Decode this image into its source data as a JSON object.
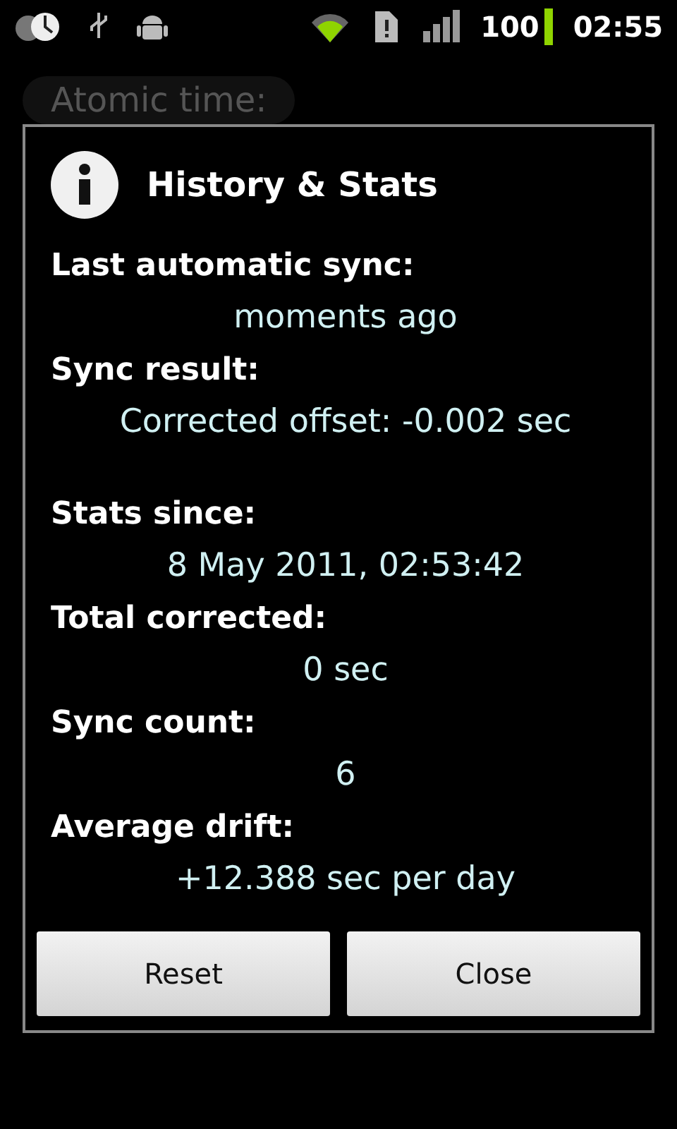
{
  "status_bar": {
    "battery": "100",
    "time": "02:55"
  },
  "background": {
    "label": "Atomic time:"
  },
  "dialog": {
    "title": "History & Stats",
    "items": [
      {
        "label": "Last automatic sync:",
        "value": "moments ago"
      },
      {
        "label": "Sync result:",
        "value": "Corrected offset: -0.002 sec"
      },
      {
        "label": "Stats since:",
        "value": "8 May 2011, 02:53:42"
      },
      {
        "label": "Total corrected:",
        "value": "0 sec"
      },
      {
        "label": "Sync count:",
        "value": "6"
      },
      {
        "label": "Average drift:",
        "value": "+12.388 sec per day"
      }
    ],
    "buttons": [
      "Reset",
      "Close"
    ]
  }
}
